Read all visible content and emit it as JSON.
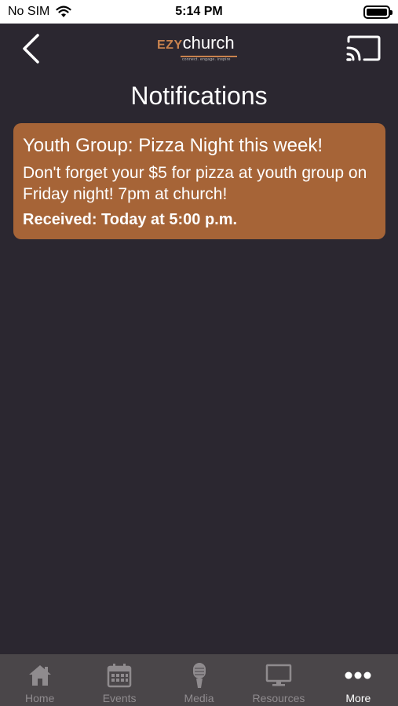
{
  "status_bar": {
    "carrier": "No SIM",
    "time": "5:14 PM"
  },
  "nav": {
    "logo_ezy": "EZY",
    "logo_church": "church",
    "logo_tagline": "connect. engage. inspire"
  },
  "page": {
    "title": "Notifications"
  },
  "notifications": [
    {
      "title": "Youth Group: Pizza Night this week!",
      "body": "Don't forget your $5 for pizza at youth group on Friday night! 7pm at church!",
      "received": "Received: Today at 5:00 p.m."
    }
  ],
  "tabs": [
    {
      "label": "Home",
      "icon": "home-icon"
    },
    {
      "label": "Events",
      "icon": "calendar-icon"
    },
    {
      "label": "Media",
      "icon": "microphone-icon"
    },
    {
      "label": "Resources",
      "icon": "monitor-icon"
    },
    {
      "label": "More",
      "icon": "more-icon",
      "active": true
    }
  ],
  "colors": {
    "background": "#2b2730",
    "accent": "#a66437",
    "tab_bar": "#4a4649",
    "tab_inactive": "#8f8b8e"
  }
}
